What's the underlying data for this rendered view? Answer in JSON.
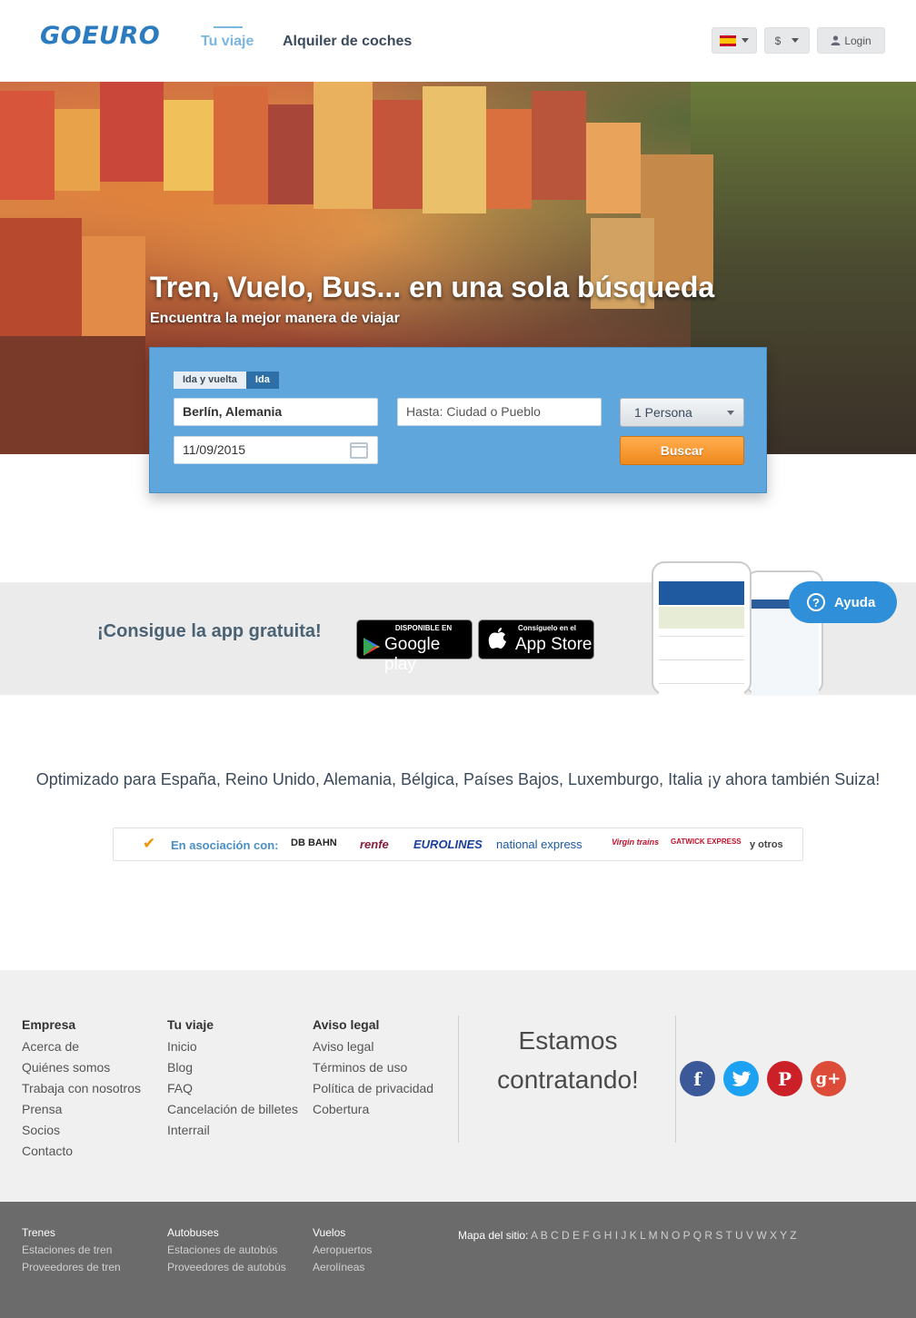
{
  "header": {
    "logo": "GOEURO",
    "nav": [
      "Tu viaje",
      "Alquiler de coches"
    ],
    "currency": "$",
    "login": "Login"
  },
  "hero": {
    "title": "Tren, Vuelo, Bus... en una sola búsqueda",
    "subtitle": "Encuentra la mejor manera de viajar"
  },
  "search": {
    "trip_options": [
      "Ida y vuelta",
      "Ida"
    ],
    "selected_trip": "Ida",
    "from_value": "Berlín, Alemania",
    "to_placeholder": "Hasta: Ciudad o Pueblo",
    "date_value": "11/09/2015",
    "passengers": "1 Persona",
    "search_button": "Buscar"
  },
  "app_promo": {
    "title": "¡Consigue la app gratuita!",
    "google_small": "DISPONIBLE EN",
    "google_big": "Google play",
    "apple_small": "Consíguelo en el",
    "apple_big": "App Store",
    "help": "Ayuda"
  },
  "optimized_text": "Optimizado para España, Reino Unido, Alemania, Bélgica, Países Bajos, Luxemburgo, Italia ¡y ahora también Suiza!",
  "partners": {
    "label": "En asociación con:",
    "logos": [
      "DB BAHN",
      "renfe",
      "EUROLINES",
      "national express",
      "Virgin trains",
      "GATWICK EXPRESS"
    ],
    "others": "y otros"
  },
  "footer": {
    "columns": [
      {
        "title": "Empresa",
        "links": [
          "Acerca de",
          "Quiénes somos",
          "Trabaja con nosotros",
          "Prensa",
          "Socios",
          "Contacto"
        ]
      },
      {
        "title": "Tu viaje",
        "links": [
          "Inicio",
          "Blog",
          "FAQ",
          "Cancelación de billetes",
          "Interrail"
        ]
      },
      {
        "title": "Aviso legal",
        "links": [
          "Aviso legal",
          "Términos de uso",
          "Política de privacidad",
          "Cobertura"
        ]
      }
    ],
    "hiring_line1": "Estamos",
    "hiring_line2": "contratando!",
    "social": [
      "facebook-icon",
      "twitter-icon",
      "pinterest-icon",
      "google-plus-icon"
    ]
  },
  "bottom": {
    "columns": [
      {
        "title": "Trenes",
        "links": [
          "Estaciones de tren",
          "Proveedores de tren"
        ]
      },
      {
        "title": "Autobuses",
        "links": [
          "Estaciones de autobús",
          "Proveedores de autobús"
        ]
      },
      {
        "title": "Vuelos",
        "links": [
          "Aeropuertos",
          "Aerolíneas"
        ]
      }
    ],
    "sitemap_label": "Mapa del sitio:",
    "sitemap_letters": "A B C D E F G H I J K L M N O P Q R S T U V W X Y Z"
  },
  "colors": {
    "brand": "#2b7bc0",
    "search_panel": "#5ea6dc",
    "search_button": "#f08a1c",
    "help_button": "#2f8fd9"
  }
}
